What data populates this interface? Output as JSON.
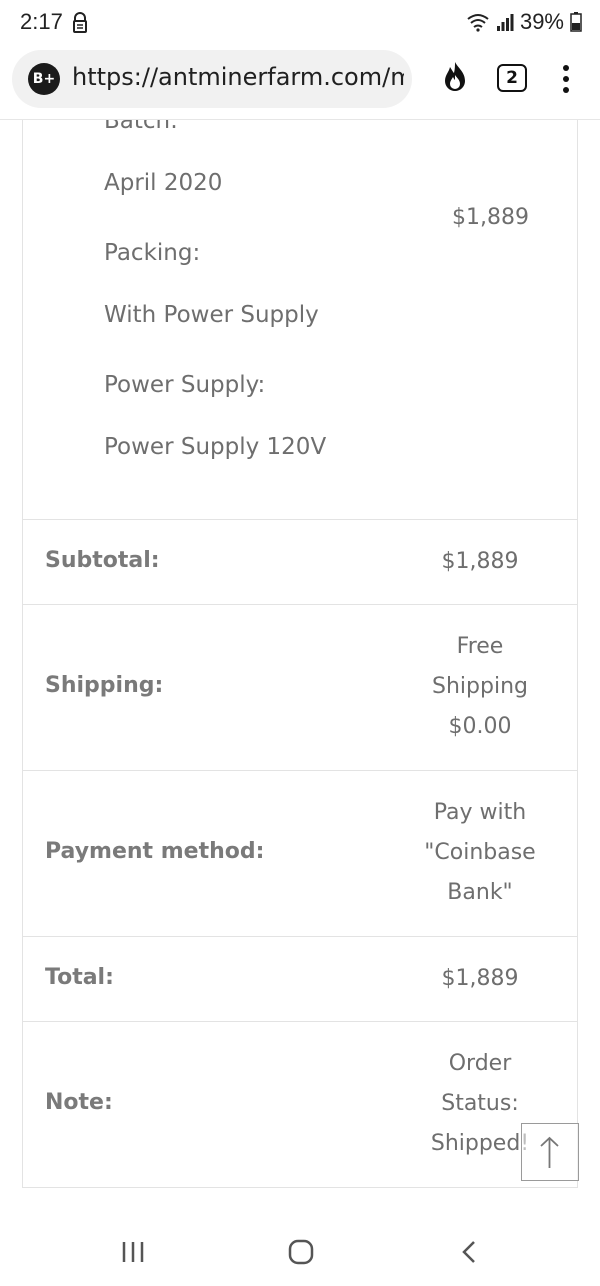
{
  "status_bar": {
    "time": "2:17",
    "battery": "39%",
    "icons": [
      "vpn-lock-icon",
      "wifi-icon",
      "signal-icon",
      "battery-icon"
    ]
  },
  "browser": {
    "badge": "B+",
    "url": "https://antminerfarm.com/my-account/view-order",
    "tab_count": "2",
    "icons": [
      "flame-icon",
      "tabs-icon",
      "more-vert-icon"
    ]
  },
  "order": {
    "product": {
      "batch_label": "Batch:",
      "batch_value": "April 2020",
      "packing_label": "Packing:",
      "packing_value": "With Power Supply",
      "power_label": "Power Supply:",
      "power_value": "Power Supply 120V",
      "price": "$1,889"
    },
    "subtotal": {
      "label": "Subtotal:",
      "value": "$1,889"
    },
    "shipping": {
      "label": "Shipping:",
      "lines": [
        "Free",
        "Shipping",
        "$0.00"
      ]
    },
    "payment": {
      "label": "Payment method:",
      "lines": [
        "Pay with",
        "\"Coinbase",
        "Bank\""
      ]
    },
    "total": {
      "label": "Total:",
      "value": "$1,889"
    },
    "note": {
      "label": "Note:",
      "lines": [
        "Order",
        "Status:",
        "Shipped!"
      ]
    }
  },
  "nav": {
    "icons": [
      "recent-apps-icon",
      "home-icon",
      "back-icon"
    ]
  },
  "colors": {
    "text": "#777777",
    "border": "#e3e3e3",
    "pill": "#f1f1f1"
  }
}
